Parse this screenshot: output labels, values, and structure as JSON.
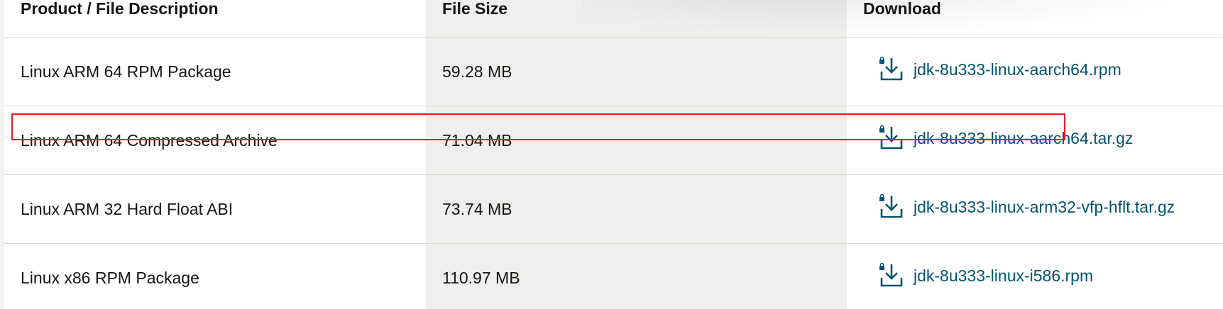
{
  "table": {
    "headers": {
      "description": "Product / File Description",
      "size": "File Size",
      "download": "Download"
    },
    "rows": [
      {
        "description": "Linux ARM 64 RPM Package",
        "size": "59.28 MB",
        "file": "jdk-8u333-linux-aarch64.rpm",
        "icon": "lock-download-icon"
      },
      {
        "description": "Linux ARM 64 Compressed Archive",
        "size": "71.04 MB",
        "file": "jdk-8u333-linux-aarch64.tar.gz",
        "icon": "lock-download-icon"
      },
      {
        "description": "Linux ARM 32 Hard Float ABI",
        "size": "73.74 MB",
        "file": "jdk-8u333-linux-arm32-vfp-hflt.tar.gz",
        "icon": "lock-download-icon"
      },
      {
        "description": "Linux x86 RPM Package",
        "size": "110.97 MB",
        "file": "jdk-8u333-linux-i586.rpm",
        "icon": "lock-download-icon"
      }
    ]
  },
  "colors": {
    "link": "#04536f",
    "size_column_background": "#f0efed",
    "highlight_border": "#e21d23"
  }
}
